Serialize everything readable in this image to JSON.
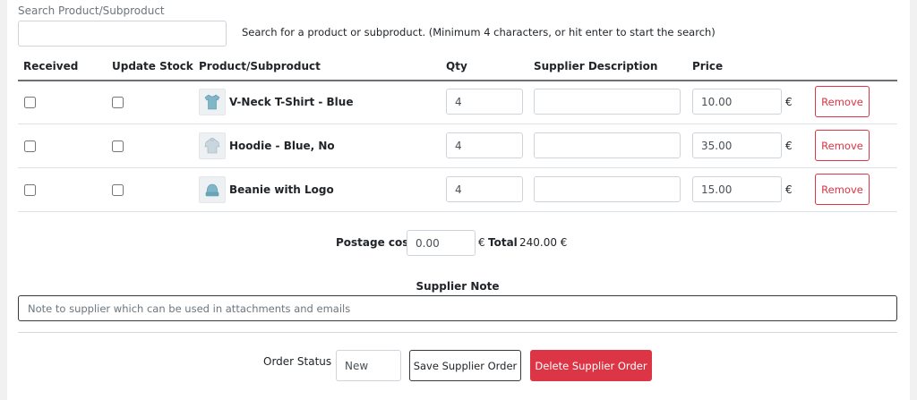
{
  "search": {
    "label": "Search Product/Subproduct",
    "value": "",
    "placeholder": "",
    "help": "Search for a product or subproduct. (Minimum 4 characters, or hit enter to start the search)"
  },
  "table": {
    "headers": {
      "received": "Received",
      "update_stock": "Update Stock",
      "product": "Product/Subproduct",
      "qty": "Qty",
      "supplier_description": "Supplier Description",
      "price": "Price"
    },
    "rows": [
      {
        "received": false,
        "update_stock": false,
        "thumb_icon": "tshirt-icon",
        "name": "V-Neck T-Shirt - Blue",
        "qty": "4",
        "supplier_description": "",
        "price": "10.00",
        "currency": "€",
        "remove_label": "Remove"
      },
      {
        "received": false,
        "update_stock": false,
        "thumb_icon": "hoodie-icon",
        "name": "Hoodie - Blue, No",
        "qty": "4",
        "supplier_description": "",
        "price": "35.00",
        "currency": "€",
        "remove_label": "Remove"
      },
      {
        "received": false,
        "update_stock": false,
        "thumb_icon": "beanie-icon",
        "name": "Beanie with Logo",
        "qty": "4",
        "supplier_description": "",
        "price": "15.00",
        "currency": "€",
        "remove_label": "Remove"
      }
    ]
  },
  "summary": {
    "postage_label": "Postage cost",
    "postage_value": "0.00",
    "postage_currency": "€",
    "total_label": "Total",
    "total_value": "240.00 €"
  },
  "note": {
    "title": "Supplier Note",
    "value": "",
    "placeholder": "Note to supplier which can be used in attachments and emails"
  },
  "footer": {
    "status_label": "Order Status",
    "status_value": "New",
    "save_label": "Save Supplier Order",
    "delete_label": "Delete Supplier Order"
  },
  "colors": {
    "danger": "#dc3545",
    "border": "#ced4da",
    "background": "#f1f1f1",
    "thumb_blue": "#7fb6c8"
  }
}
